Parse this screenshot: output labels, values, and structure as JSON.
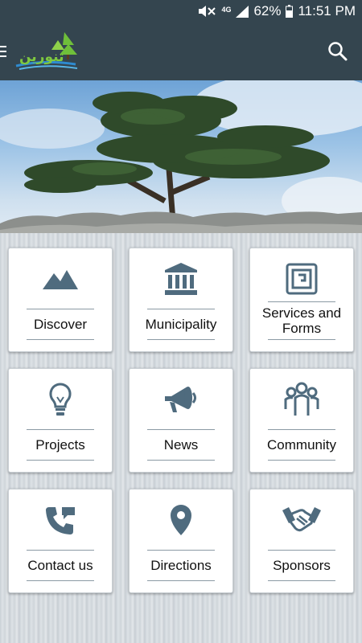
{
  "status_bar": {
    "network": "4G",
    "battery": "62%",
    "time": "11:51 PM"
  },
  "app_bar": {
    "logo_text": "ﺗﻨﻮﺭﻳﻦ",
    "menu_icon": "menu-icon",
    "search_icon": "search-icon"
  },
  "tiles": [
    {
      "label": "Discover",
      "icon": "mountain-icon"
    },
    {
      "label": "Municipality",
      "icon": "building-icon"
    },
    {
      "label": "Services and Forms",
      "icon": "forms-icon"
    },
    {
      "label": "Projects",
      "icon": "lightbulb-icon"
    },
    {
      "label": "News",
      "icon": "megaphone-icon"
    },
    {
      "label": "Community",
      "icon": "people-icon"
    },
    {
      "label": "Contact us",
      "icon": "phone-icon"
    },
    {
      "label": "Directions",
      "icon": "location-pin-icon"
    },
    {
      "label": "Sponsors",
      "icon": "handshake-icon"
    }
  ],
  "colors": {
    "app_bar": "#34454f",
    "icon": "#4f6b7e",
    "tile_bg": "#ffffff"
  }
}
